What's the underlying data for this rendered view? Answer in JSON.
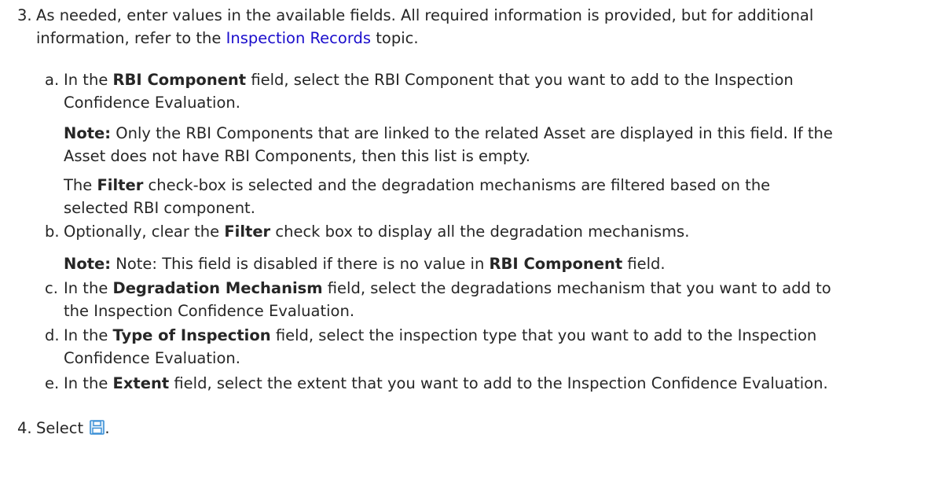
{
  "steps": [
    {
      "number": "3.",
      "text_line1": "As needed, enter values in the available fields. All required information is provided, but for additional",
      "text_line2_pre": "information, refer to the ",
      "text_line2_link": "Inspection Records",
      "text_line2_post": " topic.",
      "substeps": [
        {
          "letter": "a.",
          "pre": "In the ",
          "bold": "RBI Component",
          "post_line1": " field, select the RBI Component that you want to add to the Inspection",
          "post_line2": "Confidence Evaluation.",
          "note_label": "Note:",
          "note_line1": " Only the RBI Components that are linked to the related Asset are displayed in this field. If the",
          "note_line2": "Asset does not have RBI Components, then this list is empty.",
          "extra_pre": "The ",
          "extra_bold": "Filter",
          "extra_line1": " check-box is selected and the degradation mechanisms are filtered based on the",
          "extra_line2": "selected RBI component."
        },
        {
          "letter": "b.",
          "pre": "Optionally, clear the ",
          "bold": "Filter",
          "post": " check box to display all the degradation mechanisms.",
          "note_label": "Note:",
          "note_pre": " Note: This field is disabled if there is no value in ",
          "note_bold": "RBI Component",
          "note_post": " field."
        },
        {
          "letter": "c.",
          "pre": "In the ",
          "bold": "Degradation Mechanism",
          "post_line1": " field, select the degradations mechanism that you want to add to",
          "post_line2": "the Inspection Confidence Evaluation."
        },
        {
          "letter": "d.",
          "pre": "In the ",
          "bold": "Type of Inspection",
          "post_line1": " field, select the inspection type that you want to add to the Inspection",
          "post_line2": "Confidence Evaluation."
        },
        {
          "letter": "e.",
          "pre": "In the ",
          "bold": "Extent",
          "post": " field, select the extent that you want to add to the Inspection Confidence Evaluation."
        }
      ]
    },
    {
      "number": "4.",
      "text_pre": "Select ",
      "text_post": ".",
      "icon": "save-icon"
    }
  ],
  "colors": {
    "text": "#262626",
    "link": "#1a0dcc",
    "icon": "#3a8fd6"
  }
}
